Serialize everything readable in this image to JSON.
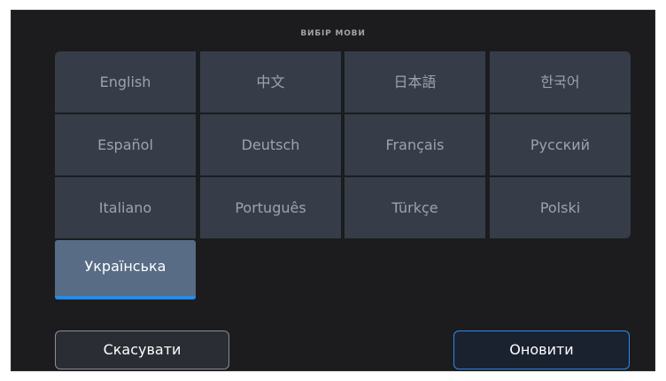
{
  "title": "ВИБІР МОВИ",
  "languages": [
    {
      "label": "English"
    },
    {
      "label": "中文"
    },
    {
      "label": "日本語"
    },
    {
      "label": "한국어"
    },
    {
      "label": "Español"
    },
    {
      "label": "Deutsch"
    },
    {
      "label": "Français"
    },
    {
      "label": "Русский"
    },
    {
      "label": "Italiano"
    },
    {
      "label": "Português"
    },
    {
      "label": "Türkçe"
    },
    {
      "label": "Polski"
    },
    {
      "label": "Українська"
    }
  ],
  "selected_language": "Українська",
  "buttons": {
    "cancel": "Скасувати",
    "update": "Оновити"
  },
  "colors": {
    "background": "#1c1c1e",
    "tile": "#363d48",
    "tile_selected": "#586c86",
    "accent": "#1f8cf0"
  }
}
